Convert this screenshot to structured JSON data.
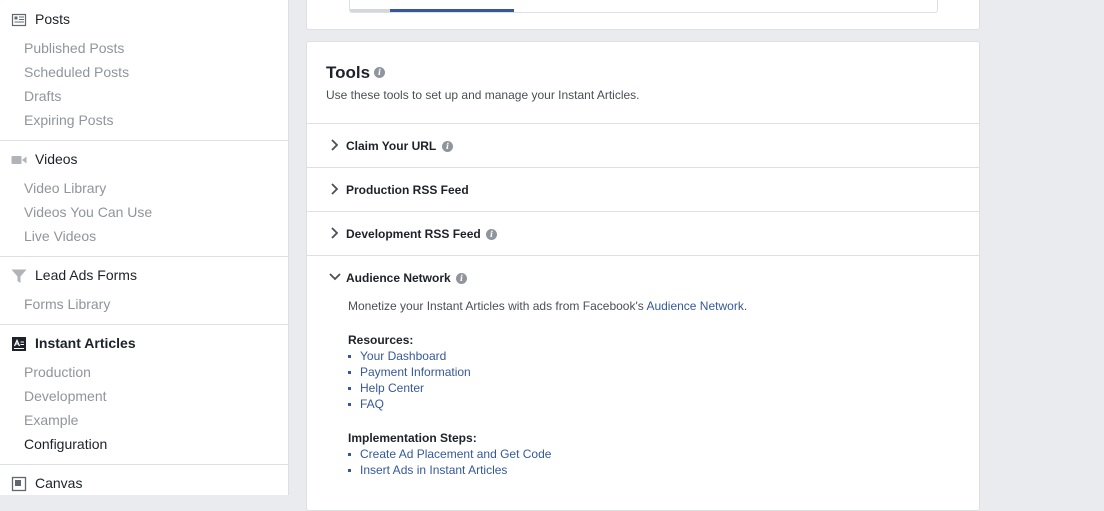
{
  "sidebar": {
    "posts": {
      "title": "Posts",
      "items": [
        "Published Posts",
        "Scheduled Posts",
        "Drafts",
        "Expiring Posts"
      ]
    },
    "videos": {
      "title": "Videos",
      "items": [
        "Video Library",
        "Videos You Can Use",
        "Live Videos"
      ]
    },
    "lead_ads": {
      "title": "Lead Ads Forms",
      "items": [
        "Forms Library"
      ]
    },
    "instant_articles": {
      "title": "Instant Articles",
      "items": [
        "Production",
        "Development",
        "Example",
        "Configuration"
      ],
      "active_item": "Configuration"
    },
    "canvas": {
      "title": "Canvas"
    }
  },
  "top_progress": {
    "fraction": 0.28
  },
  "tools": {
    "title": "Tools",
    "description": "Use these tools to set up and manage your Instant Articles.",
    "rows": [
      {
        "label": "Claim Your URL",
        "has_info": true,
        "expanded": false
      },
      {
        "label": "Production RSS Feed",
        "has_info": false,
        "expanded": false
      },
      {
        "label": "Development RSS Feed",
        "has_info": true,
        "expanded": false
      },
      {
        "label": "Audience Network",
        "has_info": true,
        "expanded": true
      }
    ],
    "audience_network": {
      "description_prefix": "Monetize your Instant Articles with ads from Facebook's ",
      "description_link": "Audience Network",
      "description_suffix": ".",
      "resources_title": "Resources:",
      "resources": [
        "Your Dashboard",
        "Payment Information",
        "Help Center",
        "FAQ"
      ],
      "steps_title": "Implementation Steps:",
      "steps": [
        "Create Ad Placement and Get Code",
        "Insert Ads in Instant Articles"
      ]
    }
  },
  "colors": {
    "link": "#365899",
    "text": "#1d2129",
    "muted": "#90949c",
    "border": "#dddfe2",
    "background": "#e9ebee"
  }
}
